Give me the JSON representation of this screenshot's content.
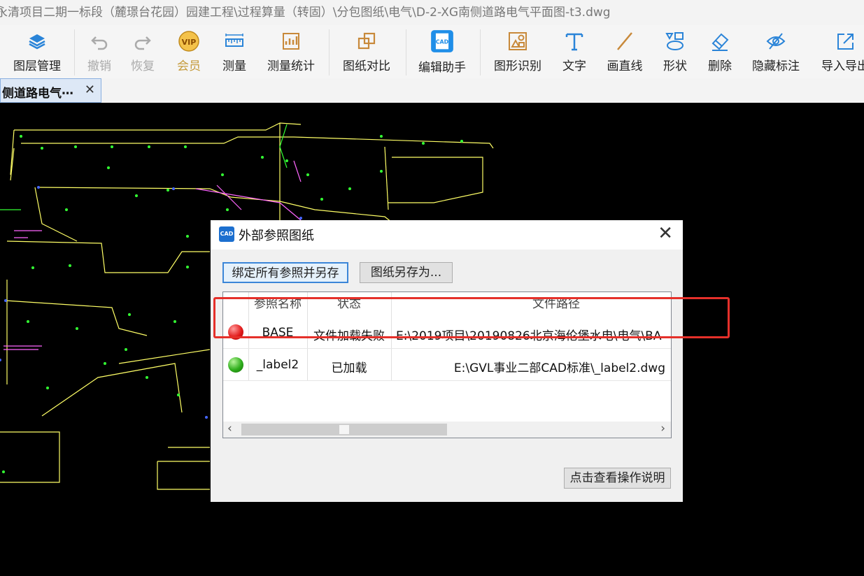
{
  "window": {
    "title": "永清项目二期一标段（麓璟台花园）园建工程\\过程算量（转固）\\分包图纸\\电气\\D-2-XG南侧道路电气平面图-t3.dwg"
  },
  "toolbar": {
    "items": [
      {
        "label": "图层管理",
        "icon": "layers-icon"
      },
      {
        "label": "撤销",
        "icon": "undo-icon"
      },
      {
        "label": "恢复",
        "icon": "redo-icon"
      },
      {
        "label": "会员",
        "icon": "vip-icon",
        "icon_text": "VIP"
      },
      {
        "label": "测量",
        "icon": "ruler-icon"
      },
      {
        "label": "测量统计",
        "icon": "measure-stats-icon"
      },
      {
        "label": "图纸对比",
        "icon": "compare-icon"
      },
      {
        "label": "编辑助手",
        "icon": "cad-edit-icon",
        "icon_text": "CAD"
      },
      {
        "label": "图形识别",
        "icon": "shape-recognize-icon"
      },
      {
        "label": "文字",
        "icon": "text-icon"
      },
      {
        "label": "画直线",
        "icon": "line-icon"
      },
      {
        "label": "形状",
        "icon": "shapes-icon"
      },
      {
        "label": "删除",
        "icon": "eraser-icon"
      },
      {
        "label": "隐藏标注",
        "icon": "hide-eye-icon"
      },
      {
        "label": "导入导出",
        "icon": "import-export-icon"
      }
    ]
  },
  "tab": {
    "label": "侧道路电气⋯",
    "close": "✕"
  },
  "dialog": {
    "logo_text": "CAD",
    "title": "外部参照图纸",
    "close": "✕",
    "bind_button": "绑定所有参照并另存",
    "save_as_button": "图纸另存为...",
    "columns": [
      "参照名称",
      "状态",
      "文件路径"
    ],
    "rows": [
      {
        "name": "BASE",
        "status": "文件加载失败",
        "status_color": "red",
        "path": "E:\\2019项目\\20190826北京海伦堡水电\\电气\\BA"
      },
      {
        "name": "_label2",
        "status": "已加载",
        "status_color": "green",
        "path": "E:\\GVL事业二部CAD标准\\_label2.dwg"
      }
    ],
    "help_button": "点击查看操作说明"
  },
  "colors": {
    "highlight_box": "#e5302a",
    "cad_background": "#000000",
    "line_yellow": "#ffff66",
    "line_green": "#33ff33",
    "line_magenta": "#ff44ff"
  }
}
